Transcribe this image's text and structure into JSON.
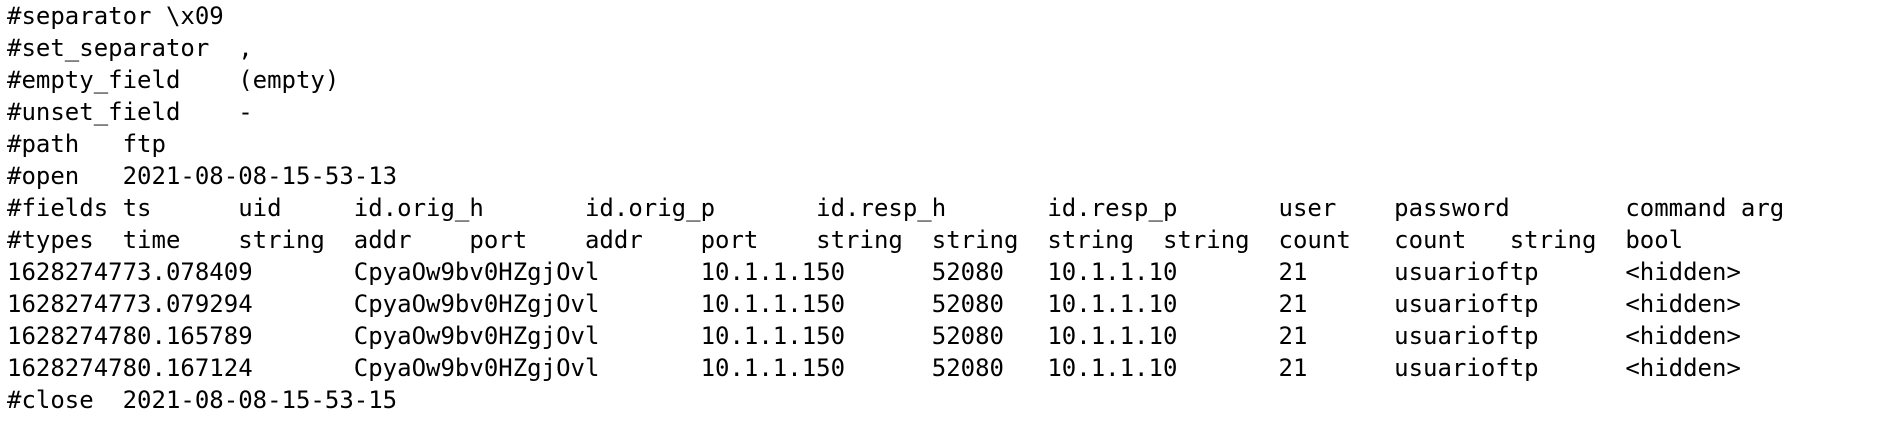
{
  "log_file": {
    "lines": [
      "#separator \\x09",
      "#set_separator\t,",
      "#empty_field\t(empty)",
      "#unset_field\t-",
      "#path\tftp",
      "#open\t2021-08-08-15-53-13",
      "#fields\tts\tuid\tid.orig_h\tid.orig_p\tid.resp_h\tid.resp_p\tuser\tpassword\tcommand\targ",
      "#types\ttime\tstring\taddr\tport\taddr\tport\tstring\tstring\tstring\tstring\tcount\tcount\tstring\tbool",
      "1628274773.078409\tCpyaOw9bv0HZgjOvl\t10.1.1.150\t52080\t10.1.1.10\t21\tusuarioftp\t<hidden>",
      "1628274773.079294\tCpyaOw9bv0HZgjOvl\t10.1.1.150\t52080\t10.1.1.10\t21\tusuarioftp\t<hidden>",
      "1628274780.165789\tCpyaOw9bv0HZgjOvl\t10.1.1.150\t52080\t10.1.1.10\t21\tusuarioftp\t<hidden>",
      "1628274780.167124\tCpyaOw9bv0HZgjOvl\t10.1.1.150\t52080\t10.1.1.10\t21\tusuarioftp\t<hidden>",
      "#close\t2021-08-08-15-53-15"
    ]
  }
}
